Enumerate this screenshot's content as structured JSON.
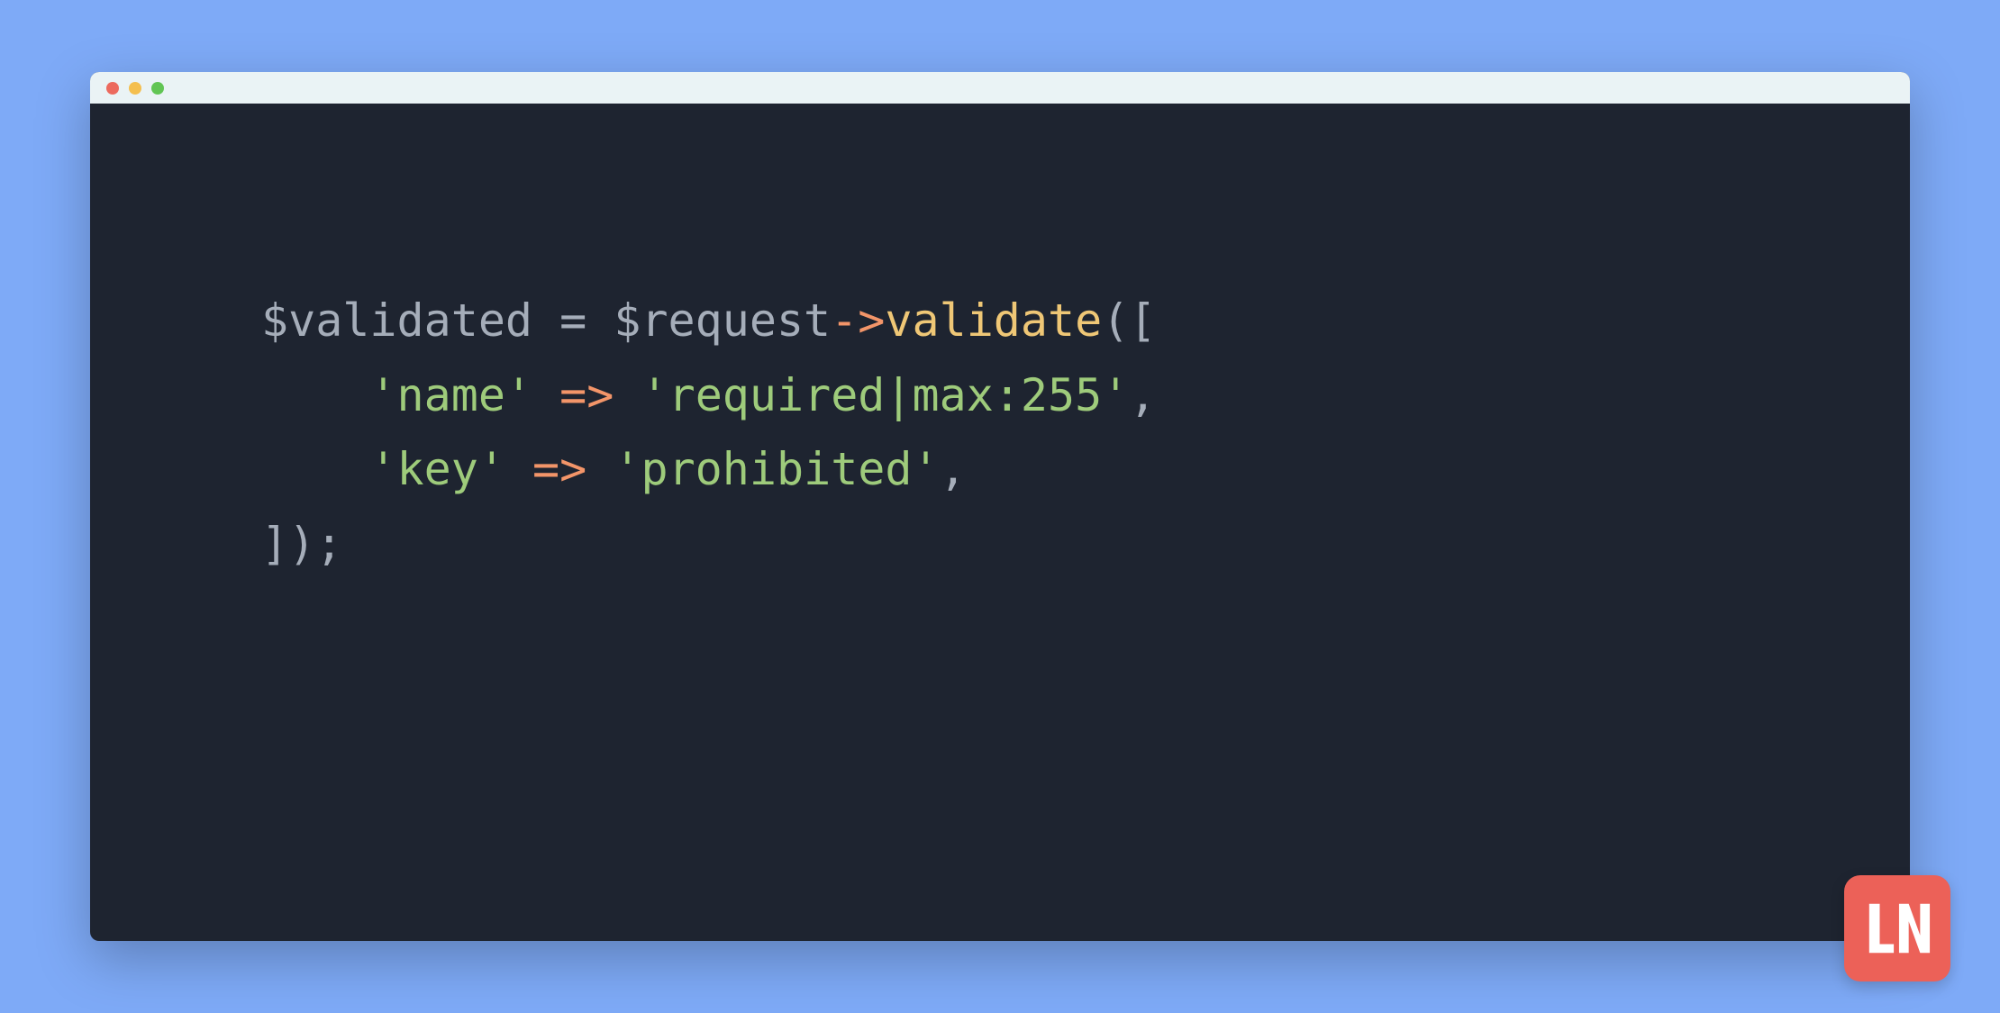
{
  "code": {
    "line1": {
      "var1": "$validated",
      "eq": " = ",
      "var2": "$request",
      "arrow": "->",
      "method": "validate",
      "open": "(["
    },
    "line2": {
      "indent": "    ",
      "key": "'name'",
      "gap1": " ",
      "fat_arrow": "=>",
      "gap2": " ",
      "value": "'required|max:255'",
      "comma": ","
    },
    "line3": {
      "indent": "    ",
      "key": "'key'",
      "gap1": " ",
      "fat_arrow": "=>",
      "gap2": " ",
      "value": "'prohibited'",
      "comma": ","
    },
    "line4": {
      "close": "]);"
    }
  },
  "logo": {
    "text": "LN"
  }
}
